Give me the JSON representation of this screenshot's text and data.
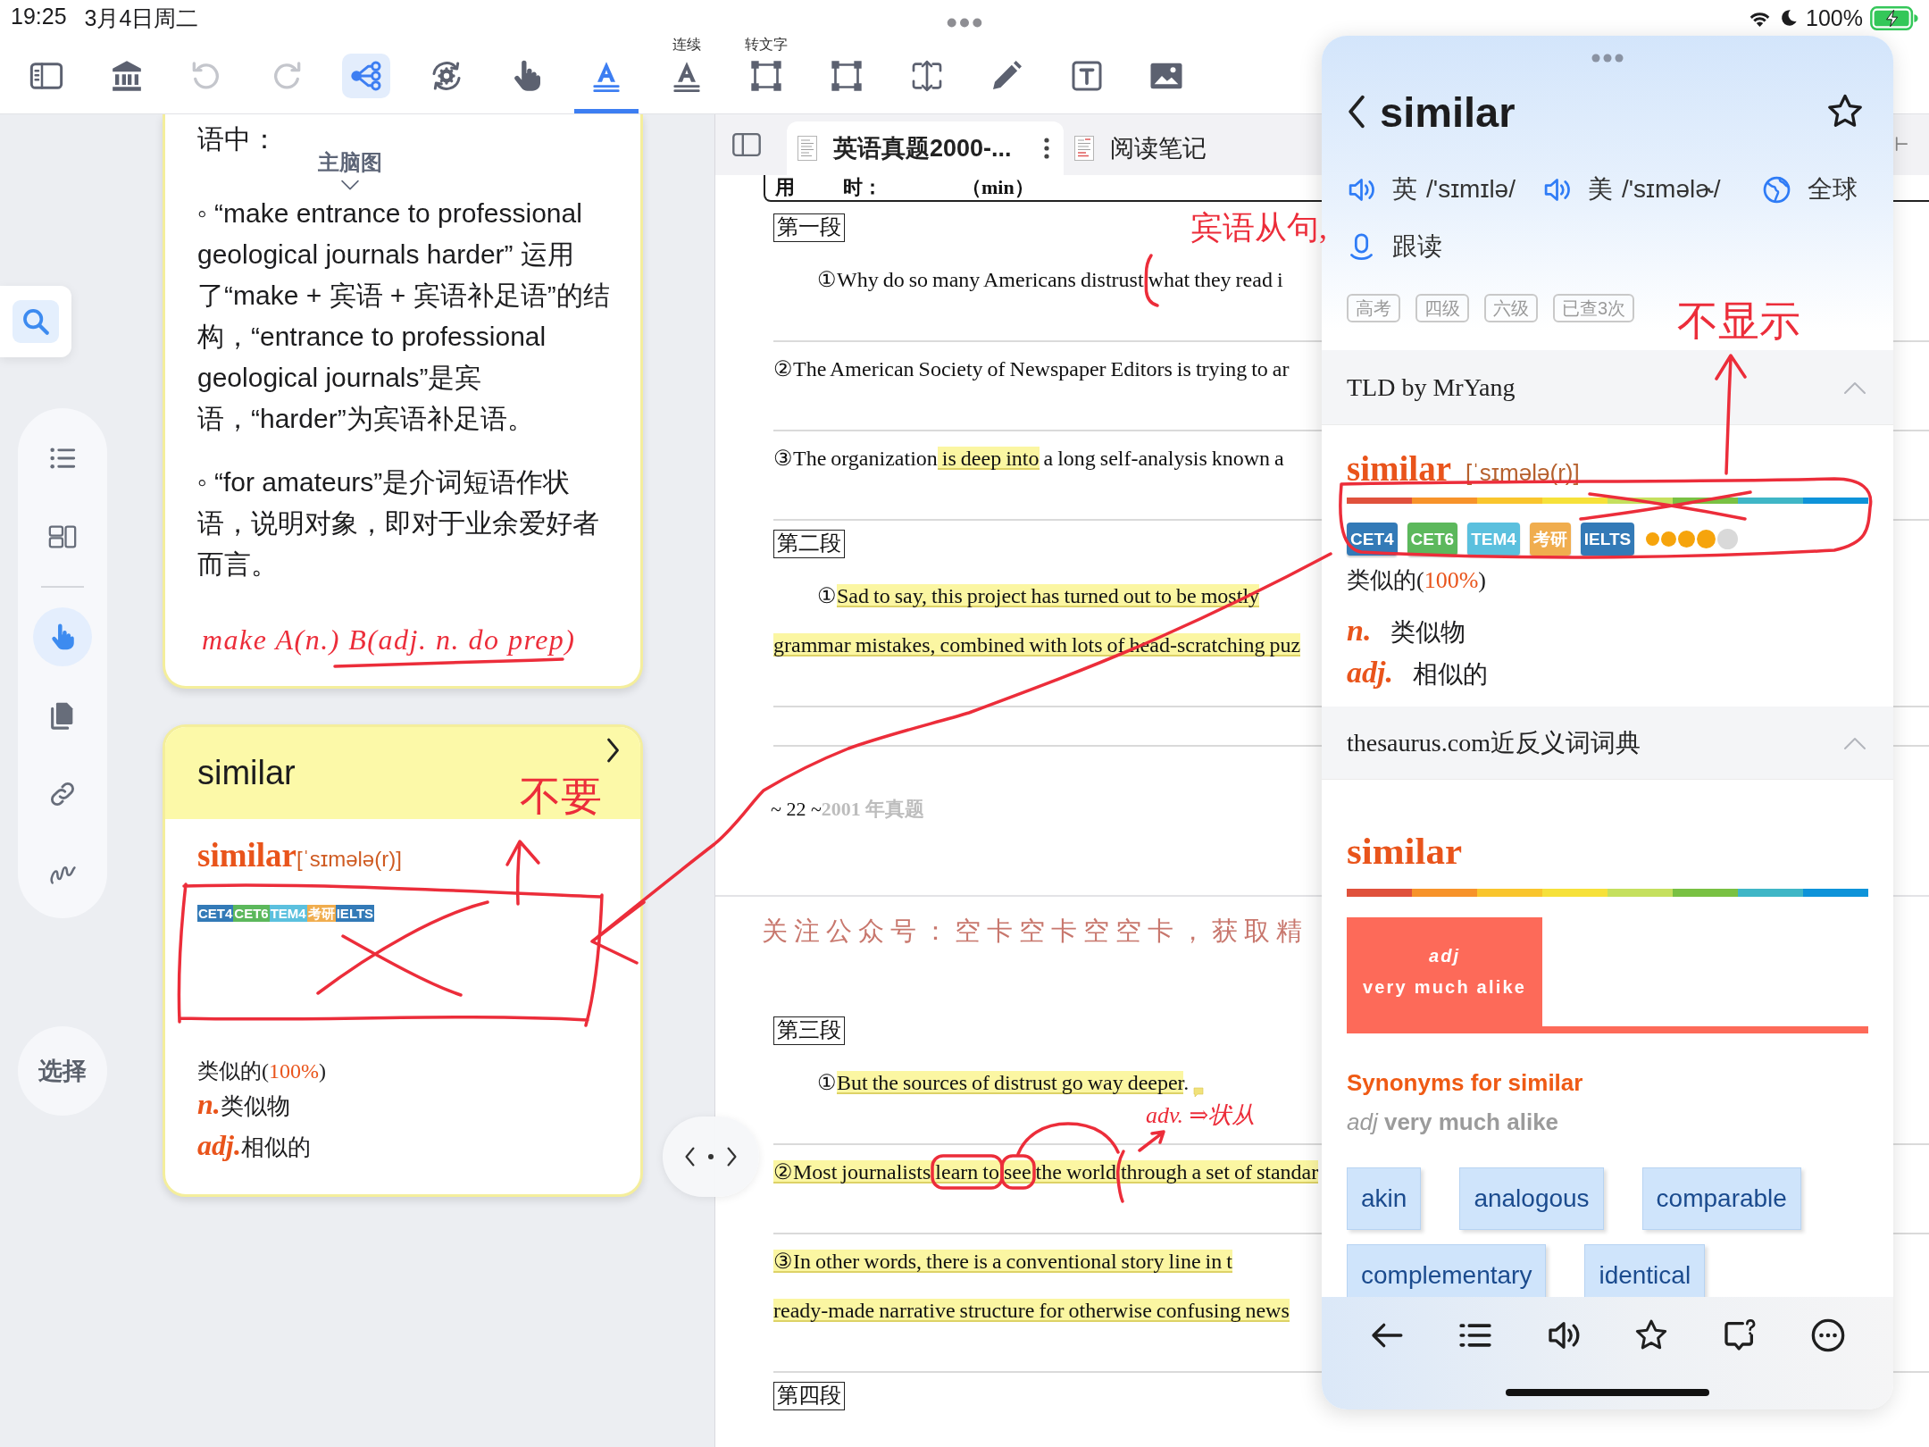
{
  "status_bar": {
    "time": "19:25",
    "date": "3月4日周二",
    "battery": "100%"
  },
  "toolbar": {
    "tools": [
      {
        "selected": false,
        "on": false,
        "disabled": false
      },
      {
        "selected": false,
        "on": false,
        "disabled": false
      },
      {
        "selected": false,
        "on": false,
        "disabled": true
      },
      {
        "selected": false,
        "on": false,
        "disabled": true
      },
      {
        "selected": false,
        "on": true,
        "disabled": false
      },
      {
        "selected": false,
        "on": false,
        "disabled": false
      },
      {
        "selected": false,
        "on": false,
        "disabled": false
      },
      {
        "selected": true,
        "on": false,
        "disabled": false
      },
      {
        "label": "连续",
        "selected": false,
        "on": false,
        "disabled": false
      },
      {
        "label": "转文字",
        "selected": false,
        "on": false,
        "disabled": false
      },
      {
        "selected": false,
        "on": false,
        "disabled": false
      },
      {
        "selected": false,
        "on": false,
        "disabled": false
      },
      {
        "selected": false,
        "on": false,
        "disabled": false
      },
      {
        "selected": false,
        "on": false,
        "disabled": false
      },
      {
        "selected": false,
        "on": false,
        "disabled": false
      }
    ]
  },
  "sidebar": {
    "search": {
      "selected": true
    },
    "tools": [
      {
        "selected": false
      },
      {
        "selected": false
      },
      {
        "selected": true
      },
      {
        "selected": false
      },
      {
        "selected": false
      },
      {
        "selected": false
      }
    ],
    "select_button": "选择"
  },
  "notes": [
    {
      "kind": "text",
      "intro": "语中：",
      "bullets": [
        "◦ “make entrance to professional geological journals harder” 运用了“make + 宾语 + 宾语补足语”的结构，“entrance to professional geological journals”是宾语，“harder”为宾语补足语。",
        "◦ “for amateurs”是介词短语作状语，说明对象，即对于业余爱好者而言。"
      ]
    },
    {
      "kind": "word",
      "title": "similar",
      "headword": "similar",
      "phonetic": "[ˈsɪmələ(r)]",
      "tags": [
        {
          "label": "CET4",
          "color": "#337ab7"
        },
        {
          "label": "CET6",
          "color": "#5cb85c"
        },
        {
          "label": "TEM4",
          "color": "#5bc0de"
        },
        {
          "label": "考研",
          "color": "#f0ad4e"
        },
        {
          "label": "IELTS",
          "color": "#337ab7"
        }
      ],
      "gloss": [
        "类似的(",
        "100%",
        ")"
      ],
      "senses": [
        {
          "pos": "n.",
          "meaning": "类似物"
        },
        {
          "pos": "adj.",
          "meaning": "相似的"
        }
      ]
    }
  ],
  "mind_map_label": "主脑图",
  "document": {
    "tabs": [
      {
        "title": "英语真题2000-...",
        "selected": true
      },
      {
        "title": "阅读笔记",
        "selected": false
      }
    ],
    "header": [
      "用",
      "时：",
      "（min）"
    ],
    "blocks": [
      {
        "kind": "heading",
        "text": "第一段"
      },
      {
        "kind": "line",
        "indent": true,
        "note": false,
        "segments": [
          {
            "text": "①Why do so many Americans distrust what they read i",
            "highlighted": false
          }
        ]
      },
      {
        "kind": "rule"
      },
      {
        "kind": "line",
        "indent": false,
        "note": false,
        "segments": [
          {
            "text": "②The American Society of Newspaper Editors is trying to ar",
            "highlighted": false
          }
        ]
      },
      {
        "kind": "rule"
      },
      {
        "kind": "line",
        "indent": false,
        "note": false,
        "segments": [
          {
            "text": "③The organization",
            "highlighted": false
          },
          {
            "text": " is deep into",
            "highlighted": true
          },
          {
            "text": " a long self-analysis known a",
            "highlighted": false
          }
        ]
      },
      {
        "kind": "rule"
      },
      {
        "kind": "heading",
        "text": "第二段"
      },
      {
        "kind": "line",
        "indent": true,
        "note": false,
        "segments": [
          {
            "text": "①",
            "highlighted": false
          },
          {
            "text": "Sad to say, this project has turned out to be mostly",
            "highlighted": true
          }
        ]
      },
      {
        "kind": "line",
        "indent": false,
        "note": false,
        "segments": [
          {
            "text": "grammar mistakes, combined with lots of head-scratching puz",
            "highlighted": true
          }
        ]
      },
      {
        "kind": "rule"
      },
      {
        "kind": "rule"
      },
      {
        "kind": "footer",
        "page": "~ 22 ~",
        "title": "2001 年真题"
      },
      {
        "kind": "page_break"
      },
      {
        "kind": "banner",
        "text": "关注公众号：空卡空卡空空卡，获取精"
      },
      {
        "kind": "heading",
        "text": "第三段"
      },
      {
        "kind": "line",
        "indent": true,
        "note": true,
        "segments": [
          {
            "text": "①",
            "highlighted": false
          },
          {
            "text": "But the sources of distrust go way deeper",
            "highlighted": true
          },
          {
            "text": ".",
            "highlighted": false
          }
        ]
      },
      {
        "kind": "rule"
      },
      {
        "kind": "line",
        "indent": false,
        "note": false,
        "segments": [
          {
            "text": "②Most journalists learn to see the world through a set of standar",
            "highlighted": true
          }
        ]
      },
      {
        "kind": "rule"
      },
      {
        "kind": "line",
        "indent": false,
        "note": false,
        "segments": [
          {
            "text": "③In other words, there is a conventional story line in t",
            "highlighted": true
          }
        ]
      },
      {
        "kind": "line",
        "indent": false,
        "note": false,
        "segments": [
          {
            "text": "ready-made narrative structure for otherwise confusing news",
            "highlighted": true
          }
        ]
      },
      {
        "kind": "rule"
      },
      {
        "kind": "heading",
        "text": "第四段"
      }
    ]
  },
  "dictionary": {
    "word": "similar",
    "starred": false,
    "pronunciations": [
      {
        "region": "英",
        "ipa": "/'sɪmɪlə/"
      },
      {
        "region": "美",
        "ipa": "/'sɪməlɚ/"
      }
    ],
    "global": "全球",
    "follow_read": "跟读",
    "tags": [
      "高考",
      "四级",
      "六级",
      "已查3次"
    ],
    "sections": [
      {
        "kind": "tld",
        "title": "TLD by MrYang",
        "expanded": true,
        "headword": "similar",
        "phonetic": "[ˈsɪmələ(r)]",
        "tags": [
          {
            "label": "CET4",
            "color": "#337ab7"
          },
          {
            "label": "CET6",
            "color": "#5cb85c"
          },
          {
            "label": "TEM4",
            "color": "#5bc0de"
          },
          {
            "label": "考研",
            "color": "#f0ad4e"
          },
          {
            "label": "IELTS",
            "color": "#337ab7"
          }
        ],
        "stars": 4,
        "gloss": [
          "类似的(",
          "100%",
          ")"
        ],
        "senses": [
          {
            "pos": "n.",
            "meaning": "类似物"
          },
          {
            "pos": "adj.",
            "meaning": "相似的"
          }
        ]
      },
      {
        "kind": "thesaurus",
        "title": "thesaurus.com近反义词词典",
        "expanded": true,
        "headword": "similar",
        "definition": {
          "pos": "adj",
          "text": "very much alike"
        },
        "synonyms_title": "Synonyms for similar",
        "summary": "*adj* **very much alike**",
        "synonyms": [
          "akin",
          "analogous",
          "comparable",
          "complementary",
          "identical"
        ]
      }
    ]
  },
  "ink": [
    {
      "text": "宾语从句,"
    },
    {
      "text": "make A(n.) B(adj. n. do prep)"
    },
    {
      "text": "不要"
    },
    {
      "text": "adv. ⇒状从"
    },
    {
      "text": "不显示"
    }
  ]
}
